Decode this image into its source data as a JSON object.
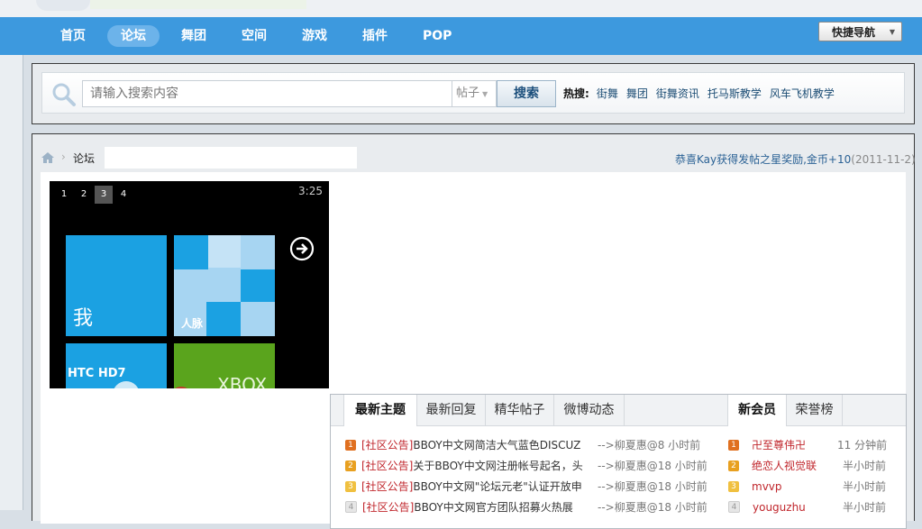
{
  "nav": {
    "items": [
      {
        "label": "首页",
        "active": false
      },
      {
        "label": "论坛",
        "active": true
      },
      {
        "label": "舞团",
        "active": false
      },
      {
        "label": "空间",
        "active": false
      },
      {
        "label": "游戏",
        "active": false
      },
      {
        "label": "插件",
        "active": false
      },
      {
        "label": "POP",
        "active": false
      }
    ],
    "quick_nav_label": "快捷导航"
  },
  "search": {
    "placeholder": "请输入搜索内容",
    "type_value": "帖子",
    "button_label": "搜索",
    "hot_label": "热搜:",
    "hot_links": [
      "街舞",
      "舞团",
      "街舞资讯",
      "托马斯教学",
      "风车飞机教学"
    ]
  },
  "breadcrumb": {
    "current": "论坛"
  },
  "notice": {
    "text": "恭喜Kay获得发帖之星奖励,金币+10",
    "date": "(2011-11-2)"
  },
  "slideshow": {
    "pages": [
      "1",
      "2",
      "3",
      "4"
    ],
    "active_page": "3",
    "time": "3:25",
    "tile_me": "我",
    "tile_people": "人脉",
    "tile_htc": "HTC HD7",
    "tile_xbox": "XBOX"
  },
  "tabs_left": [
    "最新主题",
    "最新回复",
    "精华帖子",
    "微博动态"
  ],
  "tabs_right": [
    "新会员",
    "荣誉榜"
  ],
  "threads": [
    {
      "rank": "1",
      "tag": "[社区公告]",
      "title": "BBOY中文网简洁大气蓝色DISCUZ",
      "meta": "-->柳夏惠@8 小时前"
    },
    {
      "rank": "2",
      "tag": "[社区公告]",
      "title": "关于BBOY中文网注册帐号起名，头",
      "meta": "-->柳夏惠@18 小时前"
    },
    {
      "rank": "3",
      "tag": "[社区公告]",
      "title": "BBOY中文网\"论坛元老\"认证开放申",
      "meta": "-->柳夏惠@18 小时前"
    },
    {
      "rank": "4",
      "tag": "[社区公告]",
      "title": "BBOY中文网官方团队招募火热展",
      "meta": "-->柳夏惠@18 小时前"
    }
  ],
  "members": [
    {
      "rank": "1",
      "name": "卍至尊伟卍",
      "time": "11 分钟前"
    },
    {
      "rank": "2",
      "name": "绝恋人视觉联",
      "time": "半小时前"
    },
    {
      "rank": "3",
      "name": "mvvp",
      "time": "半小时前"
    },
    {
      "rank": "4",
      "name": "youguzhu",
      "time": "半小时前"
    }
  ],
  "colors": {
    "nav_bg": "#3d99de",
    "nav_active": "#6cb3ea",
    "tag_red": "#c0262c",
    "link_blue": "#2b6295",
    "rank_colors": [
      "#e07020",
      "#e8a020",
      "#f0c040",
      "#e6e6e6"
    ]
  }
}
